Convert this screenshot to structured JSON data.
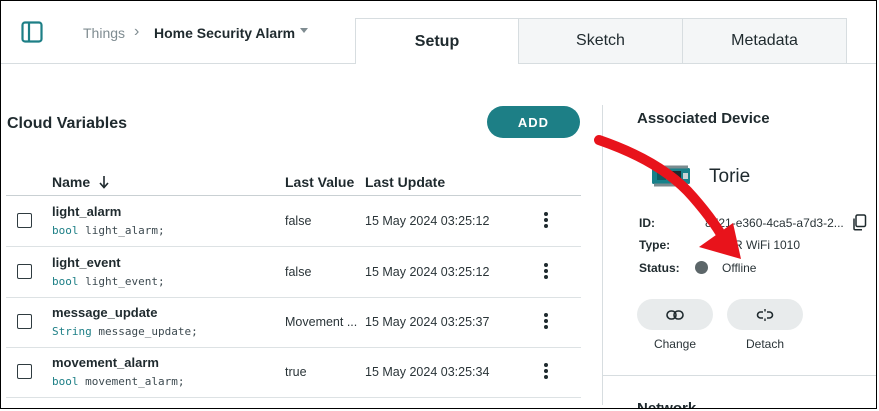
{
  "breadcrumb": {
    "parent": "Things",
    "separator": "›",
    "current": "Home Security Alarm"
  },
  "tabs": [
    {
      "label": "Setup",
      "active": true
    },
    {
      "label": "Sketch"
    },
    {
      "label": "Metadata"
    }
  ],
  "cloud_variables": {
    "title": "Cloud Variables",
    "add_label": "ADD",
    "columns": {
      "name": "Name",
      "last_value": "Last Value",
      "last_update": "Last Update"
    },
    "rows": [
      {
        "name": "light_alarm",
        "type": "bool",
        "decl": "light_alarm;",
        "value": "false",
        "updated": "15 May 2024 03:25:12"
      },
      {
        "name": "light_event",
        "type": "bool",
        "decl": "light_event;",
        "value": "false",
        "updated": "15 May 2024 03:25:12"
      },
      {
        "name": "message_update",
        "type": "String",
        "decl": "message_update;",
        "value": "Movement ...",
        "updated": "15 May 2024 03:25:37"
      },
      {
        "name": "movement_alarm",
        "type": "bool",
        "decl": "movement_alarm;",
        "value": "true",
        "updated": "15 May 2024 03:25:34"
      }
    ]
  },
  "device": {
    "section_title": "Associated Device",
    "name": "Torie",
    "id_label": "ID:",
    "id_value": "8721-e360-4ca5-a7d3-2...",
    "type_label": "Type:",
    "type_value": "o MKR WiFi 1010",
    "status_label": "Status:",
    "status_value": "Offline",
    "change_label": "Change",
    "detach_label": "Detach"
  },
  "network": {
    "title": "Network"
  },
  "colors": {
    "accent": "#1d7f86",
    "annotation": "#e8131b",
    "status_offline": "#5c6669"
  }
}
